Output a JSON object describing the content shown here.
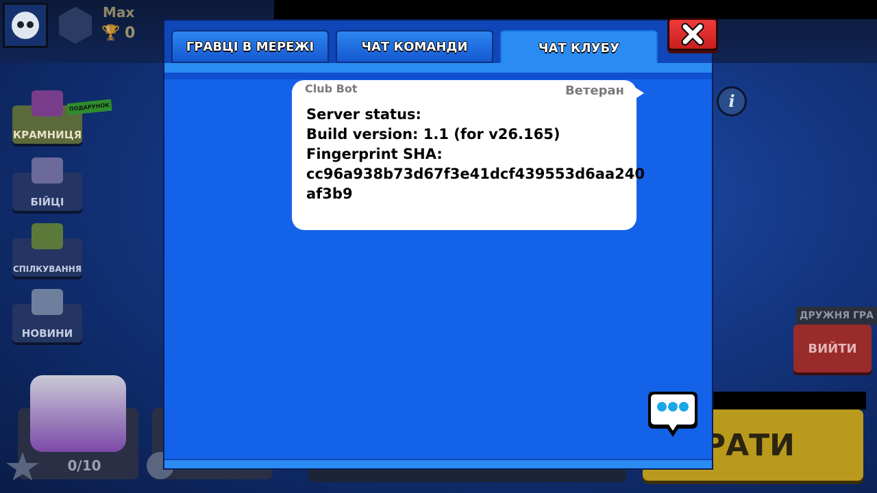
{
  "lobby": {
    "player_name": "Max",
    "trophies": "0",
    "side_menu": [
      {
        "label": "КРАМНИЦЯ",
        "badge": "ПОДАРУНОК"
      },
      {
        "label": "БІЙЦІ"
      },
      {
        "label": "СПІЛКУВАННЯ"
      },
      {
        "label": "НОВИНИ"
      }
    ],
    "box_progress": "0/10",
    "friendly_game_label": "ДРУЖНЯ ГРА",
    "exit_label": "ВИЙТИ",
    "play_label": "ГРАТИ"
  },
  "dialog": {
    "tabs": [
      {
        "label": "ГРАВЦІ В МЕРЕЖІ",
        "active": false
      },
      {
        "label": "ЧАТ КОМАНДИ",
        "active": false
      },
      {
        "label": "ЧАТ КЛУБУ",
        "active": true
      }
    ],
    "message": {
      "sender": "Club Bot",
      "rank": "Ветеран",
      "lines": [
        "Server status:",
        "Build version: 1.1 (for v26.165)",
        "Fingerprint SHA:",
        "cc96a938b73d67f3e41dcf439553d6aa240",
        "af3b9"
      ]
    }
  },
  "icons": {
    "close": "close-icon",
    "chat": "chat-bubble-icon",
    "info": "info-icon"
  },
  "colors": {
    "dialog_bg": "#1462e8",
    "tab_active": "#2a8cf2",
    "close_red": "#e02b2b",
    "chat_icon": "#1aa7e8"
  }
}
